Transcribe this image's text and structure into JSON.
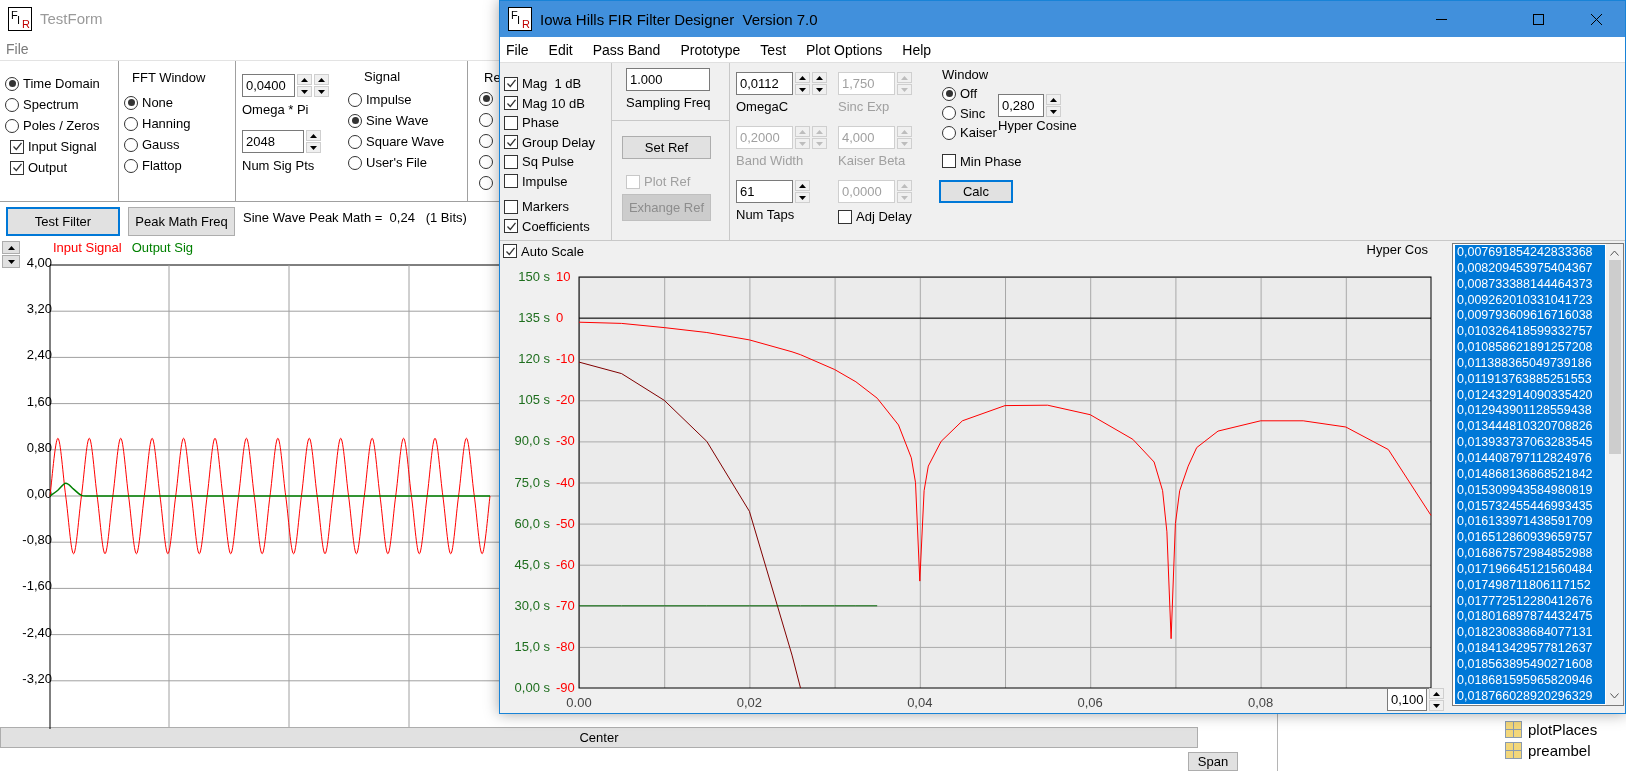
{
  "test_form": {
    "logo": [
      "F",
      "I",
      "R"
    ],
    "title": "TestForm",
    "menu": [
      {
        "label": "File"
      }
    ],
    "view_options": [
      {
        "kind": "radio",
        "label": "Time Domain",
        "selected": true
      },
      {
        "kind": "radio",
        "label": "Spectrum",
        "selected": false
      },
      {
        "kind": "radio",
        "label": "Poles / Zeros",
        "selected": false
      },
      {
        "kind": "checkbox",
        "label": "Input Signal",
        "checked": true
      },
      {
        "kind": "checkbox",
        "label": "Output",
        "checked": true
      }
    ],
    "fft_window": {
      "title": "FFT Window",
      "options": [
        {
          "label": "None",
          "selected": true
        },
        {
          "label": "Hanning",
          "selected": false
        },
        {
          "label": "Gauss",
          "selected": false
        },
        {
          "label": "Flattop",
          "selected": false
        }
      ]
    },
    "omega": {
      "value": "0,0400",
      "label": "Omega * Pi"
    },
    "num_sig_pts": {
      "value": "2048",
      "label": "Num Sig Pts"
    },
    "signal": {
      "title": "Signal",
      "options": [
        {
          "label": "Impulse",
          "selected": false
        },
        {
          "label": "Sine Wave",
          "selected": true
        },
        {
          "label": "Square Wave",
          "selected": false
        },
        {
          "label": "User's File",
          "selected": false
        }
      ]
    },
    "group_5": {
      "title": "Re",
      "options": [
        {
          "selected": true
        },
        {
          "selected": false
        },
        {
          "selected": false
        },
        {
          "selected": false
        },
        {
          "selected": false
        }
      ]
    },
    "buttons": [
      {
        "label": "Test Filter",
        "focused": true
      },
      {
        "label": "Peak Math Freq",
        "focused": false
      }
    ],
    "status": "Sine Wave Peak Math =  0,24   (1 Bits)",
    "chart_data": {
      "type": "line",
      "grid": true,
      "ylim": [
        -4,
        4
      ],
      "yticks": [
        {
          "value": 4,
          "label": "4,00"
        },
        {
          "value": 3.2,
          "label": "3,20"
        },
        {
          "value": 2.4,
          "label": "2,40"
        },
        {
          "value": 1.6,
          "label": "1,60"
        },
        {
          "value": 0.8,
          "label": "0,80"
        },
        {
          "value": 0,
          "label": "0,00"
        },
        {
          "value": -0.8,
          "label": "-0,80"
        },
        {
          "value": -1.6,
          "label": "-1,60"
        },
        {
          "value": -2.4,
          "label": "-2,40"
        },
        {
          "value": -3.2,
          "label": "-3,20"
        }
      ],
      "series": [
        {
          "name": "Input Signal",
          "color": "#ff0000",
          "values": [
            0,
            1,
            0,
            -1,
            0,
            1,
            0,
            -1,
            0,
            1,
            0,
            -1,
            0,
            1,
            0,
            -1,
            0,
            1,
            0,
            -1,
            0,
            1,
            0,
            -1,
            0,
            1,
            0,
            -1,
            0,
            1,
            0,
            -1,
            0,
            1,
            0,
            -1,
            0,
            1,
            0,
            -1,
            0,
            1,
            0,
            -1,
            0,
            1,
            0,
            -1,
            0,
            1,
            0,
            -1,
            0,
            1,
            0,
            -1,
            0
          ]
        },
        {
          "name": "Output Sig",
          "color": "#008000",
          "values": [
            0,
            0.1,
            0.22,
            0.12,
            0.01,
            0,
            0,
            0,
            0,
            0,
            0,
            0,
            0,
            0,
            0,
            0,
            0,
            0,
            0,
            0,
            0,
            0,
            0,
            0,
            0,
            0,
            0,
            0,
            0,
            0,
            0,
            0,
            0,
            0,
            0,
            0,
            0,
            0,
            0,
            0,
            0,
            0,
            0,
            0,
            0,
            0,
            0,
            0,
            0,
            0,
            0,
            0,
            0,
            0,
            0,
            0,
            0
          ]
        }
      ]
    },
    "center_bar": "Center",
    "span_button": "Span"
  },
  "fir_designer": {
    "logo": [
      "F",
      "I",
      "R"
    ],
    "title": "Iowa Hills FIR Filter Designer  Version 7.0",
    "menu": [
      {
        "label": "File"
      },
      {
        "label": "Edit"
      },
      {
        "label": "Pass Band"
      },
      {
        "label": "Prototype"
      },
      {
        "label": "Test"
      },
      {
        "label": "Plot Options"
      },
      {
        "label": "Help"
      }
    ],
    "plot_options": [
      {
        "label": "Mag  1 dB",
        "checked": true
      },
      {
        "label": "Mag 10 dB",
        "checked": true
      },
      {
        "label": "Phase",
        "checked": false
      },
      {
        "label": "Group Delay",
        "checked": true
      },
      {
        "label": "Sq Pulse",
        "checked": false
      },
      {
        "label": "Impulse",
        "checked": false
      },
      {
        "label": "Markers",
        "checked": false
      },
      {
        "label": "Coefficients",
        "checked": true
      }
    ],
    "sampling_freq": {
      "value": "1.000",
      "label": "Sampling Freq"
    },
    "set_ref_button": {
      "label": "Set Ref",
      "disabled": false
    },
    "plot_ref": {
      "label": "Plot Ref",
      "checked": false,
      "disabled": true
    },
    "exchange_ref_button": {
      "label": "Exhange Ref",
      "disabled": true
    },
    "params": [
      {
        "kind": "double_spin",
        "label": "OmegaC",
        "value": "0,0112",
        "disabled": false
      },
      {
        "kind": "single_spin",
        "label": "Sinc Exp",
        "value": "1,750",
        "disabled": true
      },
      {
        "kind": "double_spin",
        "label": "Band Width",
        "value": "0,2000",
        "disabled": true
      },
      {
        "kind": "single_spin",
        "label": "Kaiser Beta",
        "value": "4,000",
        "disabled": true
      },
      {
        "kind": "single_spin",
        "label": "Num Taps",
        "value": "61",
        "disabled": false
      },
      {
        "kind": "single_spin",
        "value": "0,0000",
        "disabled": true
      }
    ],
    "adj_delay": {
      "label": "Adj Delay",
      "checked": false
    },
    "window": {
      "title": "Window",
      "options": [
        {
          "label": "Off",
          "selected": true
        },
        {
          "label": "Sinc",
          "selected": false
        },
        {
          "label": "Kaiser",
          "selected": false
        }
      ]
    },
    "hyper_cosine": {
      "value": "0,280",
      "label": "Hyper Cosine"
    },
    "min_phase": {
      "label": "Min Phase",
      "checked": false
    },
    "calc_button": {
      "label": "Calc",
      "focused": true
    },
    "auto_scale": {
      "label": "Auto Scale",
      "checked": true
    },
    "plot_title": "Hyper Cos",
    "chart_data": {
      "type": "line",
      "grid": true,
      "xlim": [
        0,
        0.1
      ],
      "ylim": [
        -90,
        10
      ],
      "y2lim": [
        0,
        150
      ],
      "xticks": [
        {
          "value": 0,
          "label": "0.00"
        },
        {
          "value": 0.02,
          "label": "0,02"
        },
        {
          "value": 0.04,
          "label": "0,04"
        },
        {
          "value": 0.06,
          "label": "0,06"
        },
        {
          "value": 0.08,
          "label": "0,08"
        }
      ],
      "yticks": [
        10,
        0,
        -10,
        -20,
        -30,
        -40,
        -50,
        -60,
        -70,
        -80,
        -90
      ],
      "y2ticks": [
        {
          "value": 150,
          "label": "150 s"
        },
        {
          "value": 135,
          "label": "135 s"
        },
        {
          "value": 120,
          "label": "120 s"
        },
        {
          "value": 105,
          "label": "105 s"
        },
        {
          "value": 90,
          "label": "90,0 s"
        },
        {
          "value": 75,
          "label": "75,0 s"
        },
        {
          "value": 60,
          "label": "60,0 s"
        },
        {
          "value": 45,
          "label": "45,0 s"
        },
        {
          "value": 30,
          "label": "30,0 s"
        },
        {
          "value": 15,
          "label": "15,0 s"
        },
        {
          "value": 0,
          "label": "0,00 s"
        }
      ],
      "x": [
        0,
        0.005,
        0.01,
        0.015,
        0.02,
        0.025,
        0.026,
        0.03,
        0.0325,
        0.035,
        0.0375,
        0.039,
        0.0395,
        0.04,
        0.0405,
        0.041,
        0.0425,
        0.045,
        0.05,
        0.055,
        0.06,
        0.065,
        0.0675,
        0.0685,
        0.069,
        0.0695,
        0.07,
        0.0705,
        0.0715,
        0.0725,
        0.075,
        0.08,
        0.085,
        0.09,
        0.095,
        0.1
      ],
      "series": [
        {
          "color": "#ff0000",
          "axis": "y",
          "values": [
            -1,
            -1.3,
            -2.3,
            -3.5,
            -5.3,
            -8.2,
            -8.9,
            -12.5,
            -15.5,
            -19.5,
            -26,
            -34,
            -40,
            -64,
            -42,
            -36,
            -30,
            -25,
            -21.3,
            -21.2,
            -23.5,
            -29.5,
            -35,
            -42,
            -52,
            -78,
            -50,
            -42,
            -36,
            -31.5,
            -27.5,
            -25,
            -25,
            -26.5,
            -32,
            -48
          ]
        },
        {
          "color": "#800000",
          "axis": "y",
          "values": [
            -10.7,
            -13.5,
            -20,
            -30,
            -47,
            -82,
            -90,
            null,
            null,
            null,
            null,
            null,
            null,
            null,
            null,
            null,
            null,
            null,
            null,
            null,
            null,
            null,
            null,
            null,
            null,
            null,
            null,
            null,
            null,
            null,
            null,
            null,
            null,
            null,
            null,
            null
          ]
        },
        {
          "color": "#006400",
          "axis": "y2",
          "values": [
            30,
            30,
            30,
            30,
            30,
            30,
            30,
            30,
            30,
            30,
            null,
            null,
            null,
            null,
            null,
            null,
            null,
            null,
            null,
            null,
            null,
            null,
            null,
            null,
            null,
            null,
            null,
            null,
            null,
            null,
            null,
            null,
            null,
            null,
            null,
            null
          ]
        }
      ]
    },
    "range_field": {
      "value": "0,100"
    },
    "coefficients": [
      {
        "value": "0,007691854242833368",
        "selected": true
      },
      {
        "value": "0,008209453975404367",
        "selected": true
      },
      {
        "value": "0,008733388144464373",
        "selected": true
      },
      {
        "value": "0,009262010331041723",
        "selected": true
      },
      {
        "value": "0,009793609616716038",
        "selected": true
      },
      {
        "value": "0,010326418599332757",
        "selected": true
      },
      {
        "value": "0,010858621891257208",
        "selected": true
      },
      {
        "value": "0,011388365049739186",
        "selected": true
      },
      {
        "value": "0,011913763885251553",
        "selected": true
      },
      {
        "value": "0,012432914090335420",
        "selected": true
      },
      {
        "value": "0,012943901128559438",
        "selected": true
      },
      {
        "value": "0,013444810320708826",
        "selected": true
      },
      {
        "value": "0,013933737063283545",
        "selected": true
      },
      {
        "value": "0,014408797112824976",
        "selected": true
      },
      {
        "value": "0,014868136868521842",
        "selected": true
      },
      {
        "value": "0,015309943584980819",
        "selected": true
      },
      {
        "value": "0,015732455446993435",
        "selected": true
      },
      {
        "value": "0,016133971438591709",
        "selected": true
      },
      {
        "value": "0,016512860939659757",
        "selected": true
      },
      {
        "value": "0,016867572984852988",
        "selected": true
      },
      {
        "value": "0,017196645121560484",
        "selected": true
      },
      {
        "value": "0,017498711806117152",
        "selected": true
      },
      {
        "value": "0,017772512280412676",
        "selected": true
      },
      {
        "value": "0,018016897874432475",
        "selected": true
      },
      {
        "value": "0,018230838684077131",
        "selected": true
      },
      {
        "value": "0,018413429577812637",
        "selected": true
      },
      {
        "value": "0,018563895490271608",
        "selected": true
      },
      {
        "value": "0,018681595965820946",
        "selected": true
      },
      {
        "value": "0,018766028920296329",
        "selected": true
      }
    ]
  },
  "background_tree": [
    {
      "label": "plotPlaces"
    },
    {
      "label": "preambel"
    }
  ]
}
